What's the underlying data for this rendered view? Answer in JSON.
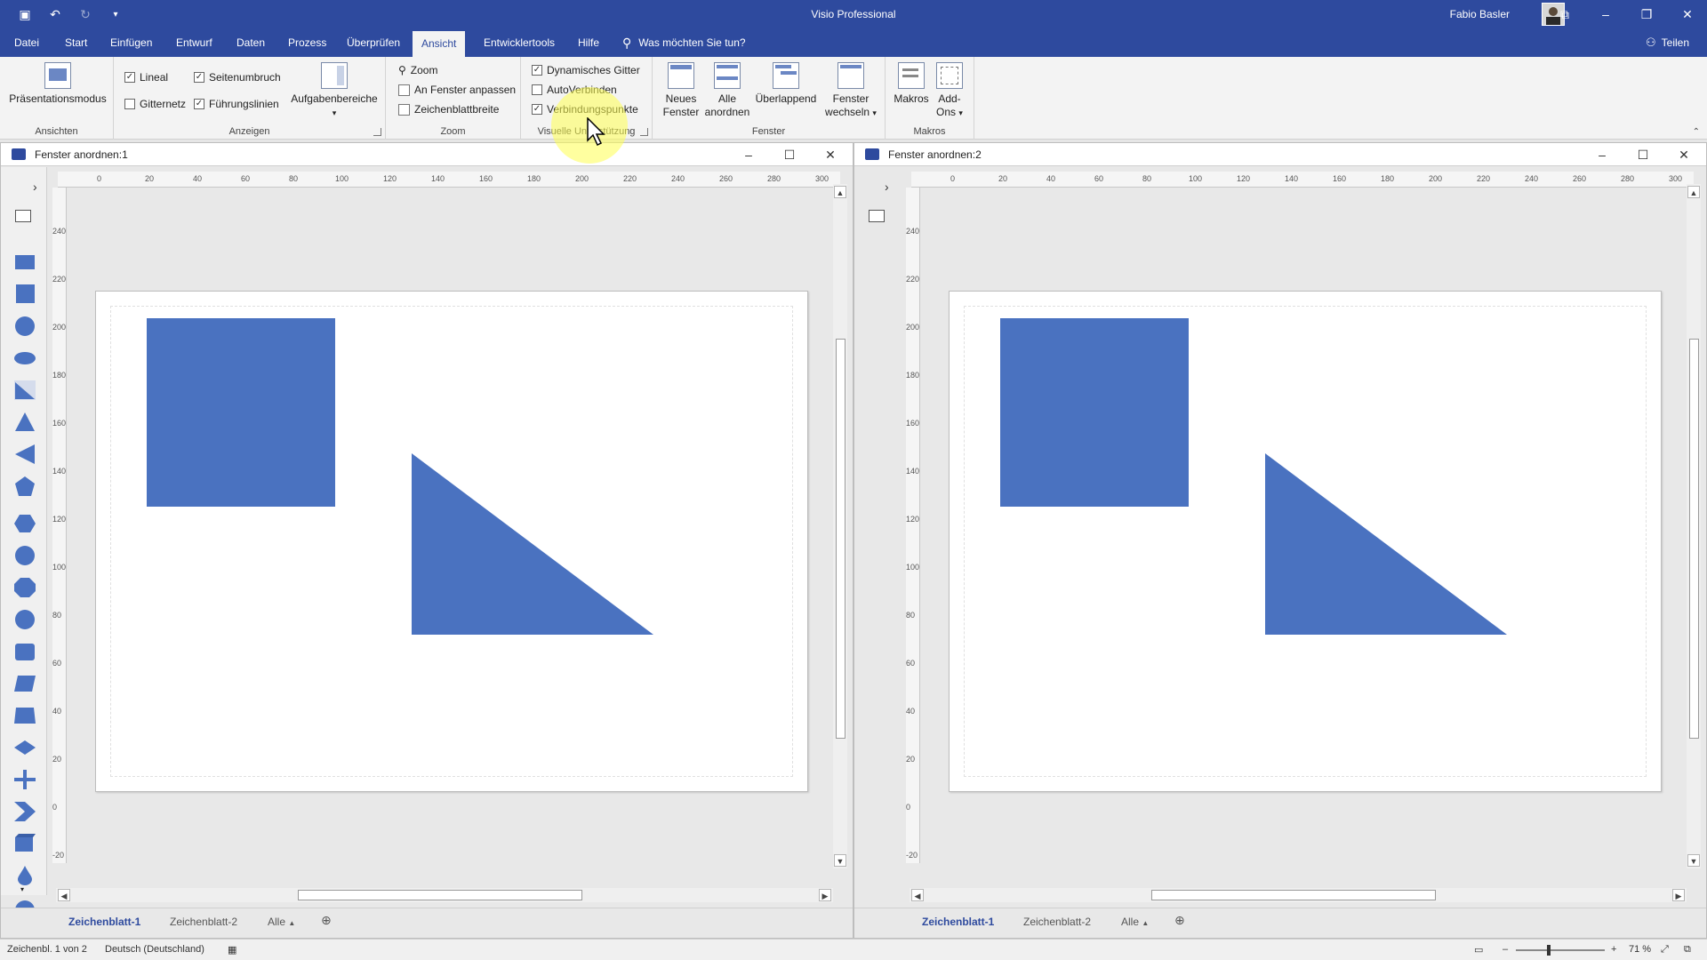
{
  "app": {
    "title": "Visio Professional",
    "user": "Fabio Basler",
    "share": "Teilen",
    "tell_me": "Was möchten Sie tun?"
  },
  "tabs": [
    "Datei",
    "Start",
    "Einfügen",
    "Entwurf",
    "Daten",
    "Prozess",
    "Überprüfen",
    "Ansicht",
    "Entwicklertools",
    "Hilfe"
  ],
  "active_tab": "Ansicht",
  "ribbon": {
    "ansichten": {
      "label": "Ansichten",
      "praesentation": "Präsentationsmodus"
    },
    "anzeigen": {
      "label": "Anzeigen",
      "lineal": "Lineal",
      "gitternetz": "Gitternetz",
      "seitenumbruch": "Seitenumbruch",
      "fuehrungslinien": "Führungslinien",
      "aufgabenbereiche": "Aufgabenbereiche"
    },
    "zoom": {
      "label": "Zoom",
      "zoom": "Zoom",
      "anpassen": "An Fenster anpassen",
      "blattbreite": "Zeichenblattbreite"
    },
    "visuell": {
      "label": "Visuelle Unterstützung",
      "gitter": "Dynamisches Gitter",
      "auto": "AutoVerbinden",
      "punkte": "Verbindungspunkte"
    },
    "fenster": {
      "label": "Fenster",
      "neu_1": "Neues",
      "neu_2": "Fenster",
      "alle_1": "Alle",
      "alle_2": "anordnen",
      "ueber": "Überlappend",
      "wechsel_1": "Fenster",
      "wechsel_2": "wechseln"
    },
    "makros": {
      "label": "Makros",
      "makros": "Makros",
      "addons_1": "Add-",
      "addons_2": "Ons"
    }
  },
  "windows": [
    {
      "title": "Fenster anordnen:1"
    },
    {
      "title": "Fenster anordnen:2"
    }
  ],
  "ruler": {
    "h": [
      "0",
      "20",
      "40",
      "60",
      "80",
      "100",
      "120",
      "140",
      "160",
      "180",
      "200",
      "220",
      "240",
      "260",
      "280",
      "300"
    ],
    "v": [
      "240",
      "220",
      "200",
      "180",
      "160",
      "140",
      "120",
      "100",
      "80",
      "60",
      "40",
      "20",
      "0",
      "-20"
    ]
  },
  "sheets": {
    "s1": "Zeichenblatt-1",
    "s2": "Zeichenblatt-2",
    "all": "Alle"
  },
  "colors": {
    "shape_fill": "#4a72c0",
    "brand": "#2e4a9e"
  },
  "status": {
    "page": "Zeichenbl. 1 von 2",
    "lang": "Deutsch (Deutschland)",
    "zoom": "71 %"
  }
}
